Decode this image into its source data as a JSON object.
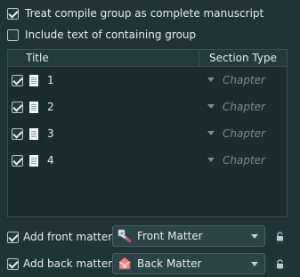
{
  "options": {
    "treat_as_manuscript": {
      "label": "Treat compile group as complete manuscript",
      "checked": true
    },
    "include_group_text": {
      "label": "Include text of containing group",
      "checked": false
    }
  },
  "table": {
    "columns": [
      "Title",
      "Section Type"
    ],
    "rows": [
      {
        "checked": true,
        "title": "1",
        "section_type": "Chapter"
      },
      {
        "checked": true,
        "title": "2",
        "section_type": "Chapter"
      },
      {
        "checked": true,
        "title": "3",
        "section_type": "Chapter"
      },
      {
        "checked": true,
        "title": "4",
        "section_type": "Chapter"
      }
    ]
  },
  "front_matter": {
    "checked": true,
    "label": "Add front matter:",
    "value": "Front Matter",
    "icon": "front-matter-icon"
  },
  "back_matter": {
    "checked": true,
    "label": "Add back matter:",
    "value": "Back Matter",
    "icon": "back-matter-icon"
  }
}
